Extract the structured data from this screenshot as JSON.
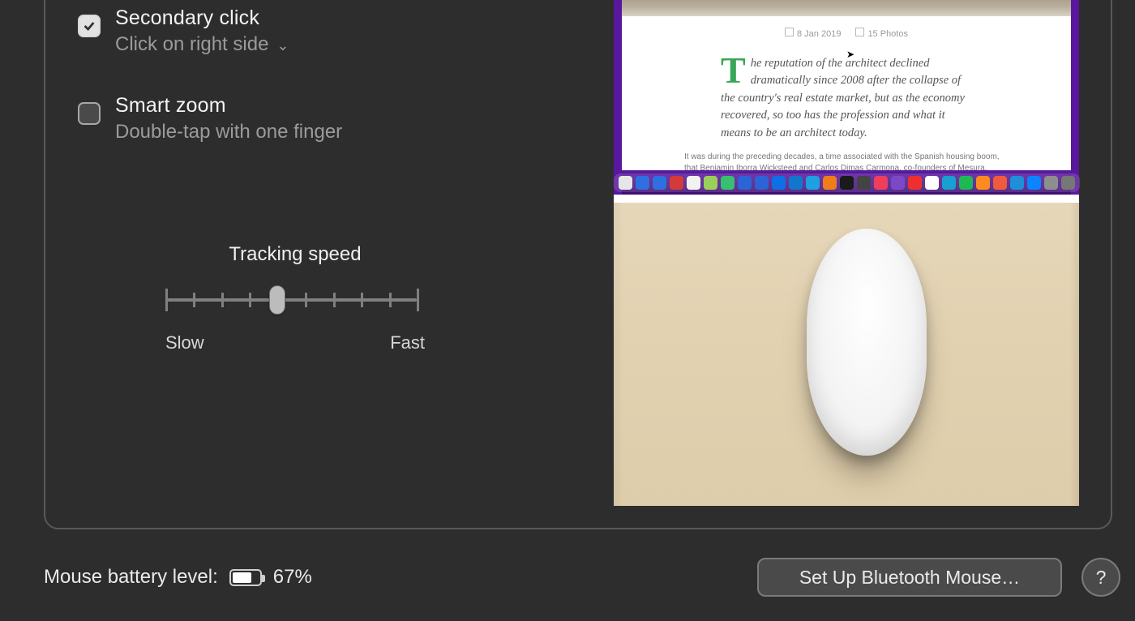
{
  "options": {
    "secondary_click": {
      "title": "Secondary click",
      "subtitle": "Click on right side",
      "checked": true
    },
    "smart_zoom": {
      "title": "Smart zoom",
      "subtitle": "Double-tap with one finger",
      "checked": false
    }
  },
  "tracking": {
    "title": "Tracking speed",
    "ticks": 10,
    "value_index": 4,
    "min_label": "Slow",
    "max_label": "Fast"
  },
  "preview": {
    "meta_date": "8 Jan 2019",
    "meta_photos": "15 Photos",
    "body": "he reputation of the architect declined dramatically since 2008 after the collapse of the country's real estate market, but as the economy recovered, so too has the profession and what it means to be an architect today.",
    "fine": "It was during the preceding decades, a time associated with the Spanish housing boom, that Benjamin Iborra Wicksteed and Carlos Dimas Carmona, co-founders of Mesura,",
    "apple_logo": "",
    "dock_colors": [
      "#e6e6e6",
      "#2f6fe0",
      "#2f6fe0",
      "#d53a3a",
      "#f2f2f2",
      "#9acf5a",
      "#36c06f",
      "#2c63d6",
      "#2c63d6",
      "#0f70e6",
      "#1277cc",
      "#1fa0e0",
      "#ef7d1a",
      "#1a1a1a",
      "#444",
      "#ee3e5c",
      "#7b48c7",
      "#ef2f2f",
      "#ffffff",
      "#17a0d0",
      "#1db954",
      "#ff8a1f",
      "#ef5b3c",
      "#1f8fd8",
      "#0a84ff",
      "#8e8e8e",
      "#777"
    ]
  },
  "footer": {
    "battery_label": "Mouse battery level:",
    "battery_percent_text": "67%",
    "battery_percent_value": 67,
    "bluetooth_button": "Set Up Bluetooth Mouse…",
    "help": "?"
  }
}
